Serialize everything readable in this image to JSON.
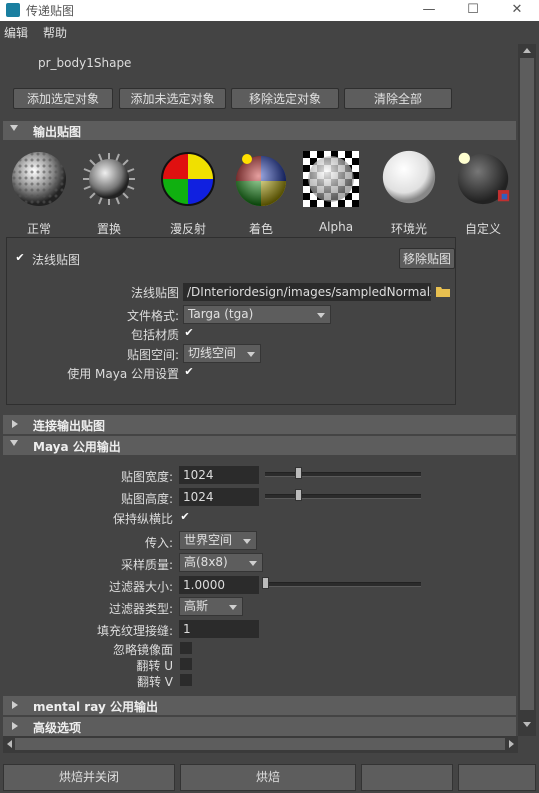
{
  "window": {
    "title": "传递贴图",
    "minimize": "—",
    "maximize": "☐",
    "close": "✕"
  },
  "menu": [
    "编辑",
    "帮助"
  ],
  "shape_name": "pr_body1Shape",
  "top_buttons": [
    "添加选定对象",
    "添加未选定对象",
    "移除选定对象",
    "清除全部"
  ],
  "sections": {
    "output_maps": "输出贴图",
    "connect_output": "连接输出贴图",
    "maya_common": "Maya 公用输出",
    "mental_ray": "mental ray 公用输出",
    "advanced": "高级选项"
  },
  "map_types": [
    {
      "label": "正常",
      "icon": "normal-map-icon"
    },
    {
      "label": "置换",
      "icon": "displacement-map-icon"
    },
    {
      "label": "漫反射",
      "icon": "diffuse-map-icon"
    },
    {
      "label": "着色",
      "icon": "shading-map-icon"
    },
    {
      "label": "Alpha",
      "icon": "alpha-map-icon"
    },
    {
      "label": "环境光",
      "icon": "ambient-occlusion-icon"
    },
    {
      "label": "自定义",
      "icon": "custom-map-icon"
    }
  ],
  "normal_map": {
    "header_label": "法线贴图",
    "remove_button": "移除贴图",
    "path_label": "法线贴图",
    "path_value": "/DInteriordesign/images/sampledNormals.tga",
    "format_label": "文件格式:",
    "format_value": "Targa (tga)",
    "include_material_label": "包括材质",
    "include_material_checked": true,
    "space_label": "贴图空间:",
    "space_value": "切线空间",
    "use_common_label": "使用 Maya 公用设置",
    "use_common_checked": true
  },
  "common": {
    "width_label": "贴图宽度:",
    "width_value": "1024",
    "width_slider": 0.2,
    "height_label": "贴图高度:",
    "height_value": "1024",
    "height_slider": 0.2,
    "keep_aspect_label": "保持纵横比",
    "keep_aspect_checked": true,
    "transfer_label": "传入:",
    "transfer_value": "世界空间",
    "sampling_label": "采样质量:",
    "sampling_value": "高(8x8)",
    "filter_size_label": "过滤器大小:",
    "filter_size_value": "1.0000",
    "filter_size_slider": 0.0,
    "filter_type_label": "过滤器类型:",
    "filter_type_value": "高斯",
    "fill_seam_label": "填充纹理接缝:",
    "fill_seam_value": "1",
    "ignore_mirror_label": "忽略镜像面",
    "flip_u_label": "翻转 U",
    "flip_v_label": "翻转 V"
  },
  "footer": {
    "bake_close": "烘焙并关闭",
    "bake": "烘焙",
    "btn3": "",
    "btn4": ""
  },
  "colors": {
    "panel": "#444444",
    "section": "#5d5d5d",
    "field": "#2b2b2b"
  }
}
